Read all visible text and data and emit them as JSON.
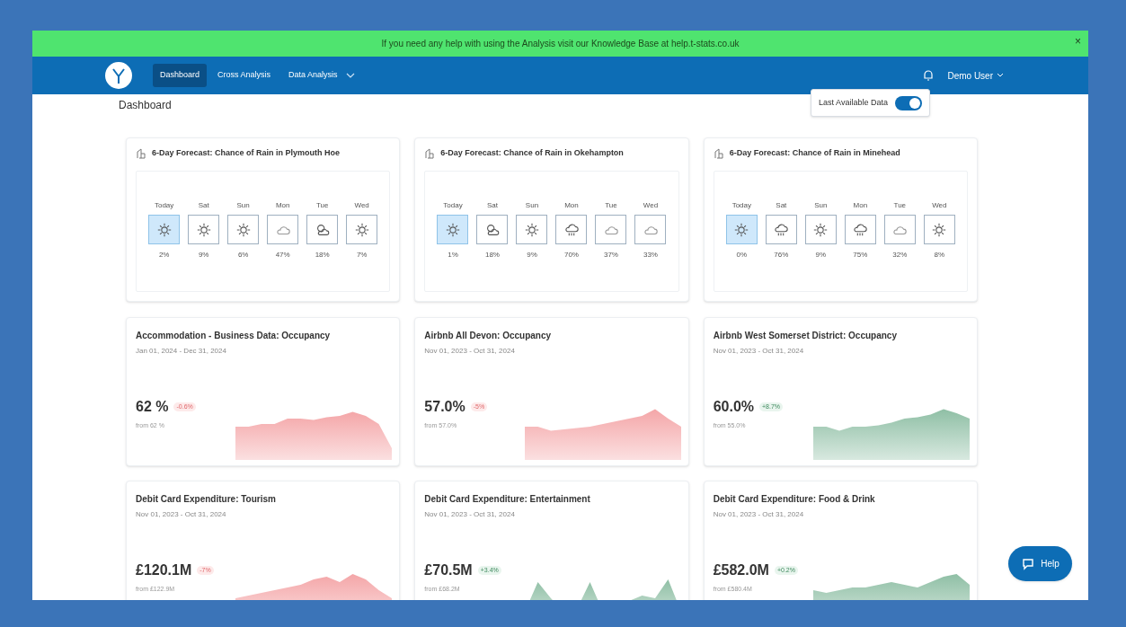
{
  "banner": {
    "text": "If you need any help with using the Analysis visit our Knowledge Base at help.t-stats.co.uk",
    "close": "×"
  },
  "nav": {
    "items": [
      {
        "label": "Dashboard",
        "selected": true,
        "dropdown": false
      },
      {
        "label": "Cross Analysis",
        "selected": false,
        "dropdown": false
      },
      {
        "label": "Data Analysis",
        "selected": false,
        "dropdown": true
      }
    ],
    "user": "Demo User"
  },
  "page": {
    "title": "Dashboard",
    "toggle": {
      "label": "Last Available Data",
      "on": true
    }
  },
  "forecasts": [
    {
      "title": "6-Day Forecast: Chance of Rain in Plymouth Hoe",
      "days": [
        {
          "day": "Today",
          "kind": "sun",
          "chance": "2%",
          "selected": true
        },
        {
          "day": "Sat",
          "kind": "sun",
          "chance": "9%",
          "selected": false
        },
        {
          "day": "Sun",
          "kind": "sun",
          "chance": "6%",
          "selected": false
        },
        {
          "day": "Mon",
          "kind": "cloud",
          "chance": "47%",
          "selected": false
        },
        {
          "day": "Tue",
          "kind": "partly",
          "chance": "18%",
          "selected": false
        },
        {
          "day": "Wed",
          "kind": "sun",
          "chance": "7%",
          "selected": false
        }
      ]
    },
    {
      "title": "6-Day Forecast: Chance of Rain in Okehampton",
      "days": [
        {
          "day": "Today",
          "kind": "sun",
          "chance": "1%",
          "selected": true
        },
        {
          "day": "Sat",
          "kind": "partly",
          "chance": "18%",
          "selected": false
        },
        {
          "day": "Sun",
          "kind": "sun",
          "chance": "9%",
          "selected": false
        },
        {
          "day": "Mon",
          "kind": "rain",
          "chance": "70%",
          "selected": false
        },
        {
          "day": "Tue",
          "kind": "cloud",
          "chance": "37%",
          "selected": false
        },
        {
          "day": "Wed",
          "kind": "cloud",
          "chance": "33%",
          "selected": false
        }
      ]
    },
    {
      "title": "6-Day Forecast: Chance of Rain in Minehead",
      "days": [
        {
          "day": "Today",
          "kind": "sun",
          "chance": "0%",
          "selected": true
        },
        {
          "day": "Sat",
          "kind": "rain",
          "chance": "76%",
          "selected": false
        },
        {
          "day": "Sun",
          "kind": "sun",
          "chance": "9%",
          "selected": false
        },
        {
          "day": "Mon",
          "kind": "rain",
          "chance": "75%",
          "selected": false
        },
        {
          "day": "Tue",
          "kind": "cloud",
          "chance": "32%",
          "selected": false
        },
        {
          "day": "Wed",
          "kind": "sun",
          "chance": "8%",
          "selected": false
        }
      ]
    }
  ],
  "metrics": [
    {
      "title": "Accommodation - Business Data: Occupancy",
      "range": "Jan 01, 2024 - Dec 31, 2024",
      "value": "62 %",
      "change": "-0.6%",
      "kind": "down",
      "from": "from 62 %"
    },
    {
      "title": "Airbnb All Devon: Occupancy",
      "range": "Nov 01, 2023 - Oct 31, 2024",
      "value": "57.0%",
      "change": "-5%",
      "kind": "down",
      "from": "from 57.0%"
    },
    {
      "title": "Airbnb West Somerset District: Occupancy",
      "range": "Nov 01, 2023 - Oct 31, 2024",
      "value": "60.0%",
      "change": "+8.7%",
      "kind": "up",
      "from": "from 55.0%"
    },
    {
      "title": "Debit Card Expenditure: Tourism",
      "range": "Nov 01, 2023 - Oct 31, 2024",
      "value": "£120.1M",
      "change": "-7%",
      "kind": "down",
      "from": "from £122.9M"
    },
    {
      "title": "Debit Card Expenditure: Entertainment",
      "range": "Nov 01, 2023 - Oct 31, 2024",
      "value": "£70.5M",
      "change": "+3.4%",
      "kind": "up",
      "from": "from £68.2M"
    },
    {
      "title": "Debit Card Expenditure: Food & Drink",
      "range": "Nov 01, 2023 - Oct 31, 2024",
      "value": "£582.0M",
      "change": "+0.2%",
      "kind": "up",
      "from": "from £580.4M"
    }
  ],
  "help": {
    "label": "Help"
  }
}
